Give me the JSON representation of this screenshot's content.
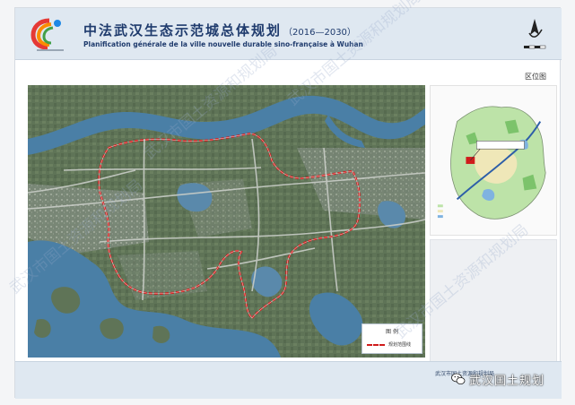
{
  "header": {
    "title_cn": "中法武汉生态示范城总体规划",
    "years": "（2016—2030）",
    "title_fr": "Planification générale de la ville nouvelle durable sino-française à Wuhan"
  },
  "inset": {
    "label": "区位图"
  },
  "legend": {
    "title": "图 例",
    "item_label": "规划范围线"
  },
  "footer": {
    "agency": "武汉市国土资源和规划局"
  },
  "watermark": {
    "badge_text": "武汉国土规划",
    "diagonal_text": "武汉市国土资源和规划局"
  },
  "colors": {
    "boundary": "#d01b1b",
    "water": "#4a7fa6",
    "land": "#667a60",
    "header_bg": "#dfe8f1",
    "title": "#1f3b6d"
  }
}
